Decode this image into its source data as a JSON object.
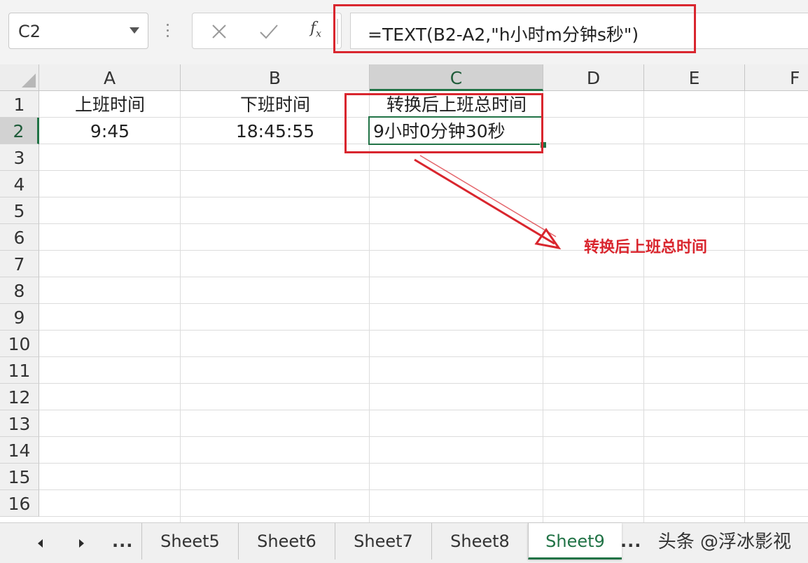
{
  "name_box": {
    "value": "C2"
  },
  "formula_bar": {
    "cancel_icon": "close-x-icon",
    "enter_icon": "check-icon",
    "fx_label": "fx",
    "formula": "=TEXT(B2-A2,\"h小时m分钟s秒\")"
  },
  "columns": [
    "A",
    "B",
    "C",
    "D",
    "E",
    "F"
  ],
  "rows": [
    "1",
    "2",
    "3",
    "4",
    "5",
    "6",
    "7",
    "8",
    "9",
    "10",
    "11",
    "12",
    "13",
    "14",
    "15",
    "16"
  ],
  "active_cell": {
    "col": "C",
    "row": "2"
  },
  "cells": {
    "A1": "上班时间",
    "B1": "下班时间",
    "C1": "转换后上班总时间",
    "A2": "9:45",
    "B2": "18:45:55",
    "C2": "9小时0分钟30秒"
  },
  "annotation": {
    "label": "转换后上班总时间",
    "color": "#d9262e"
  },
  "sheet_tabs": {
    "nav_ellipsis": "...",
    "more_ellipsis": "...",
    "tabs": [
      "Sheet5",
      "Sheet6",
      "Sheet7",
      "Sheet8",
      "Sheet9"
    ],
    "active": "Sheet9"
  },
  "watermark": "头条 @浮冰影视",
  "colors": {
    "accent": "#217346",
    "annotation_red": "#d9262e"
  }
}
